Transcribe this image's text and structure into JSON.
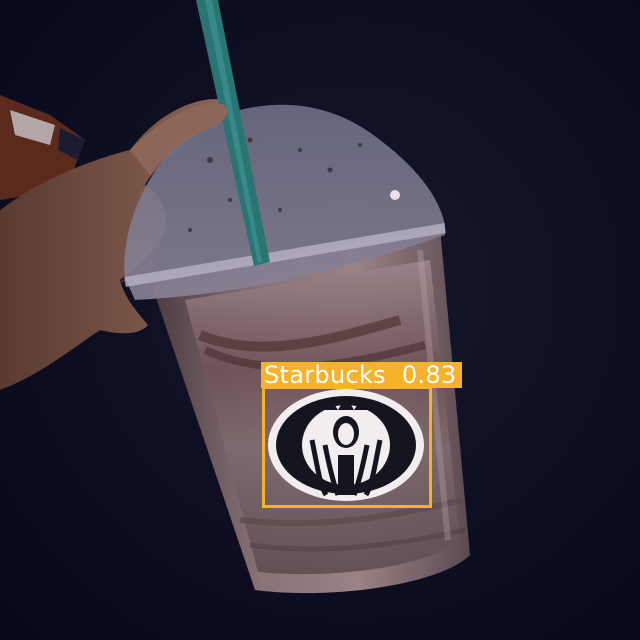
{
  "detections": [
    {
      "label": "Starbucks",
      "score": "0.83",
      "color": "#f5b22a"
    }
  ],
  "scene": {
    "subject": "iced-drink-cup-icon",
    "background": "#0b0d1e"
  }
}
